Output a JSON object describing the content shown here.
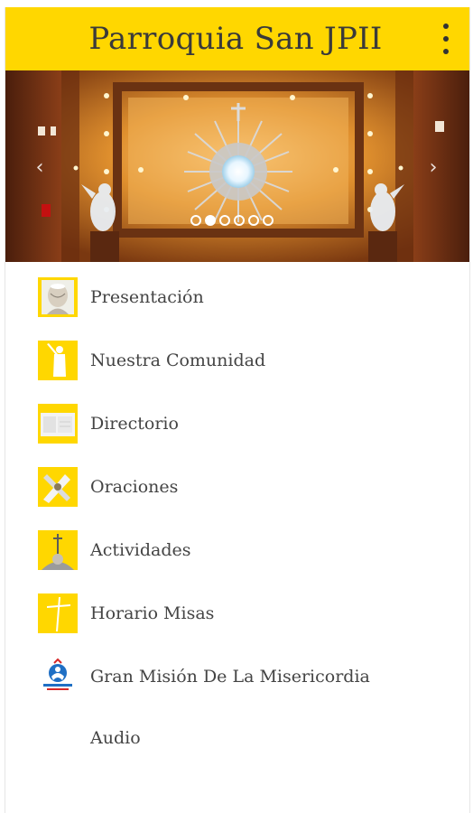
{
  "header": {
    "title": "Parroquia San JPII",
    "bar_color": "#ffd700",
    "menu_icon": "more-vert-icon"
  },
  "carousel": {
    "slide_count": 6,
    "active_index": 1,
    "prev_icon": "chevron-left-icon",
    "next_icon": "chevron-right-icon"
  },
  "menu": {
    "items": [
      {
        "label": "Presentación",
        "icon": "pope-portrait-icon"
      },
      {
        "label": "Nuestra Comunidad",
        "icon": "statue-silhouette-icon"
      },
      {
        "label": "Directorio",
        "icon": "directory-icon"
      },
      {
        "label": "Oraciones",
        "icon": "praying-hands-icon"
      },
      {
        "label": "Actividades",
        "icon": "pope-crozier-icon"
      },
      {
        "label": "Horario Misas",
        "icon": "cross-icon"
      },
      {
        "label": "Gran Misión De La Misericordia",
        "icon": "mision-misericordia-logo-icon"
      },
      {
        "label": "Audio",
        "icon": ""
      }
    ]
  }
}
